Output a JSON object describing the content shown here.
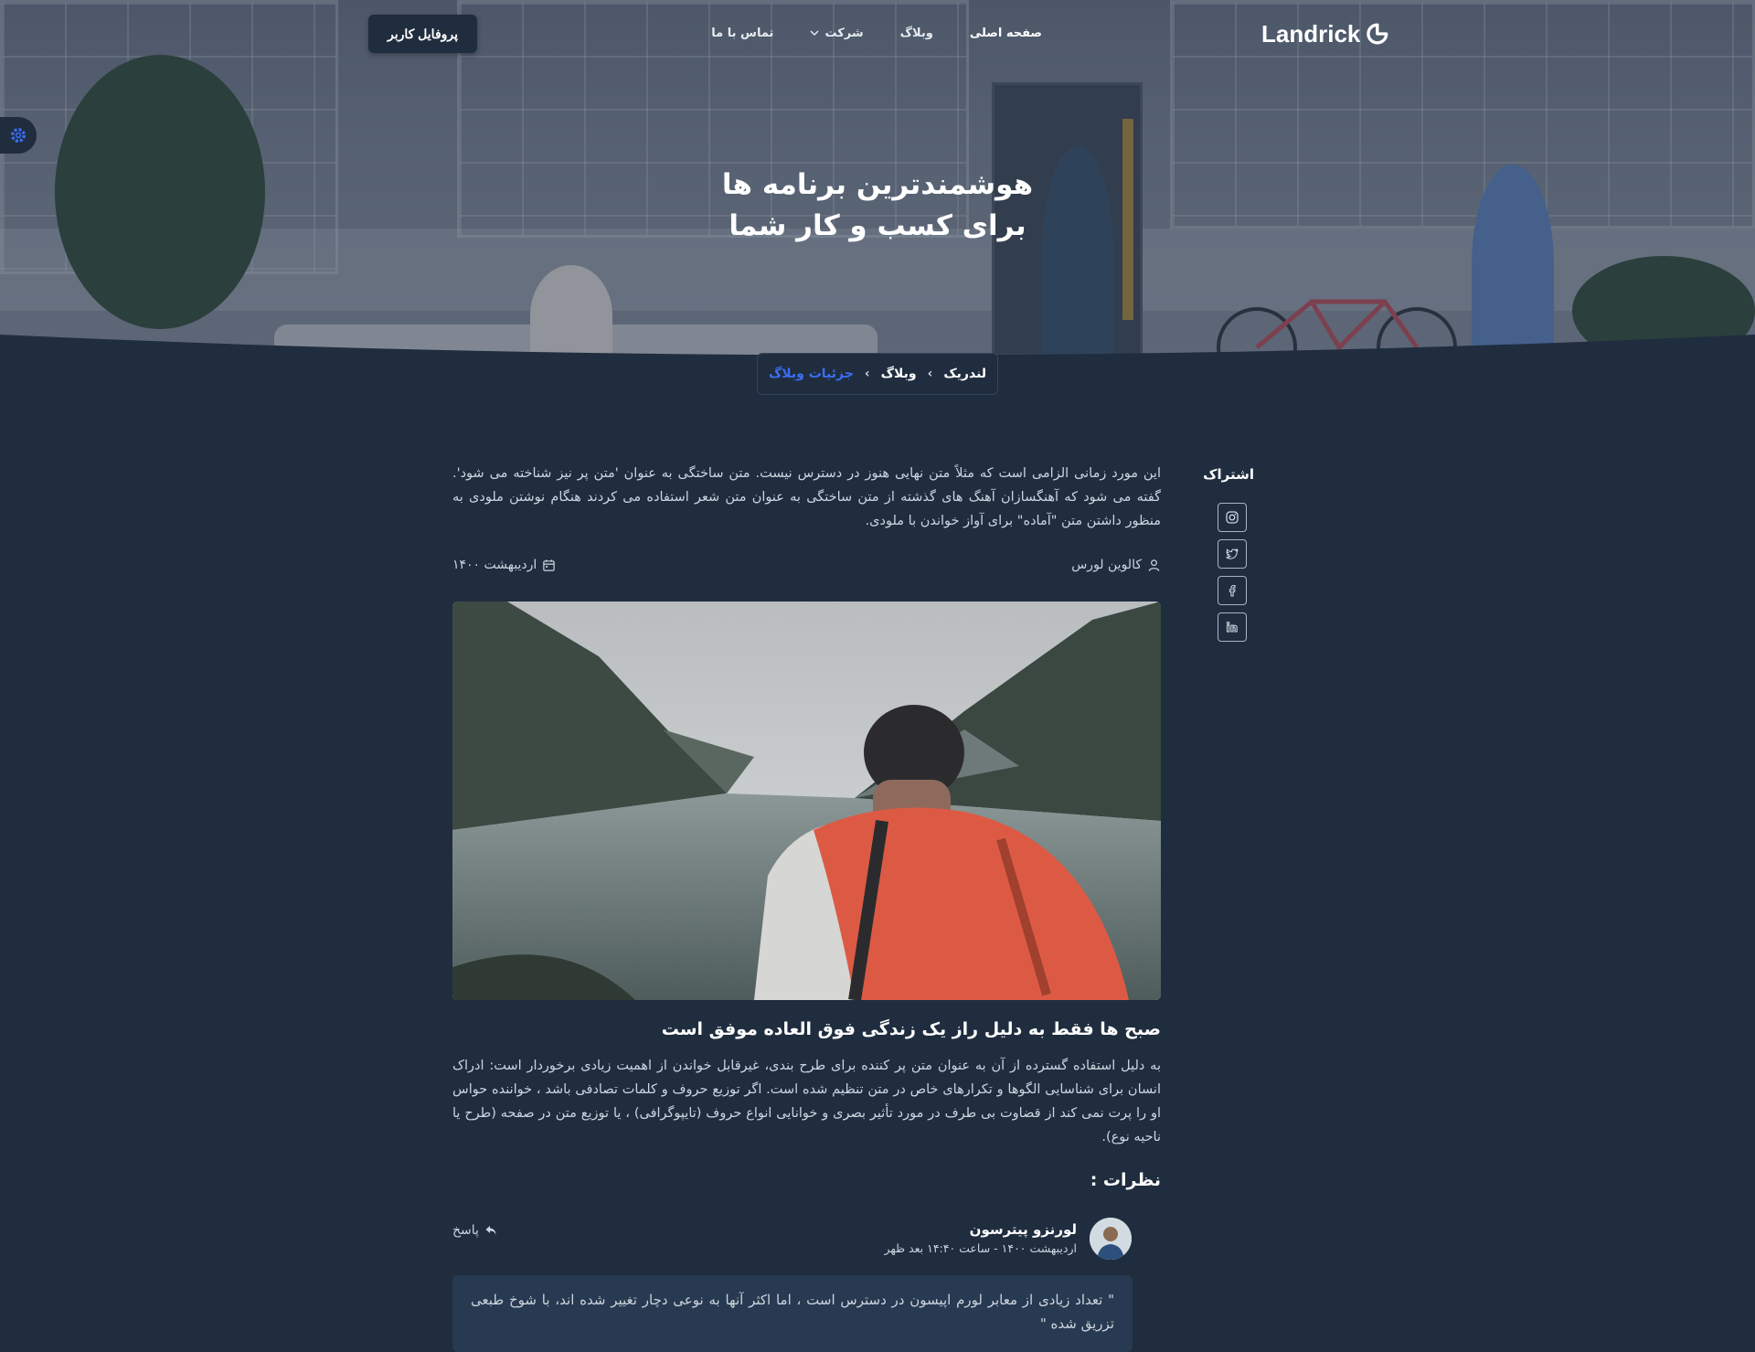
{
  "nav": {
    "logo": "Landrick",
    "menu": [
      {
        "label": "صفحه اصلی"
      },
      {
        "label": "وبلاگ"
      },
      {
        "label": "شرکت"
      },
      {
        "label": "تماس با ما"
      }
    ],
    "profile_button": "پروفایل کاربر"
  },
  "hero": {
    "title_line1": "هوشمندترین برنامه ها",
    "title_line2": "برای کسب و کار شما"
  },
  "breadcrumb": {
    "items": [
      "لندریک",
      "وبلاگ",
      "جزئیات وبلاگ"
    ],
    "separator": "›"
  },
  "sidebar": {
    "share_title": "اشتراک",
    "share_icons": [
      "instagram-icon",
      "twitter-icon",
      "facebook-icon",
      "linkedin-icon"
    ]
  },
  "post": {
    "intro": "این مورد زمانی الزامی است که مثلاً متن نهایی هنوز در دسترس نیست. متن ساختگی به عنوان 'متن پر نیز شناخته می شود'. گفته می شود که آهنگسازان آهنگ های گذشته از متن ساختگی به عنوان متن شعر استفاده می کردند هنگام نوشتن ملودی به منظور داشتن متن \"آماده\" برای آواز خواندن با ملودی.",
    "author": "کالوین لورس",
    "date": "اردیبهشت ۱۴۰۰",
    "title": "صبح ها فقط به دلیل راز یک زندگی فوق العاده موفق است",
    "body": "به دلیل استفاده گسترده از آن به عنوان متن پر کننده برای طرح بندی، غیرقابل خواندن از اهمیت زیادی برخوردار است: ادراک انسان برای شناسایی الگوها و تکرارهای خاص در متن تنظیم شده است. اگر توزیع حروف و کلمات تصادفی باشد ، خواننده حواس او را پرت نمی کند از قضاوت بی طرف در مورد تأثیر بصری و خوانایی انواع حروف (تایپوگرافی) ، یا توزیع متن در صفحه (طرح یا ناحیه نوع)."
  },
  "comments": {
    "title": "نظرات :",
    "items": [
      {
        "name": "لورنزو پیترسون",
        "date": "اردیبهشت ۱۴۰۰ - ساعت ۱۴:۴۰ بعد ظهر",
        "reply": "پاسخ",
        "text": "\" تعداد زیادی از معابر لورم اپیسون در دسترس است ، اما اکثر آنها به نوعی دچار تغییر شده اند، با شوخ طبعی تزریق شده \""
      }
    ]
  },
  "colors": {
    "background": "#1f2d3f",
    "accent": "#3b6ef5",
    "quote_bg": "#283a51"
  }
}
